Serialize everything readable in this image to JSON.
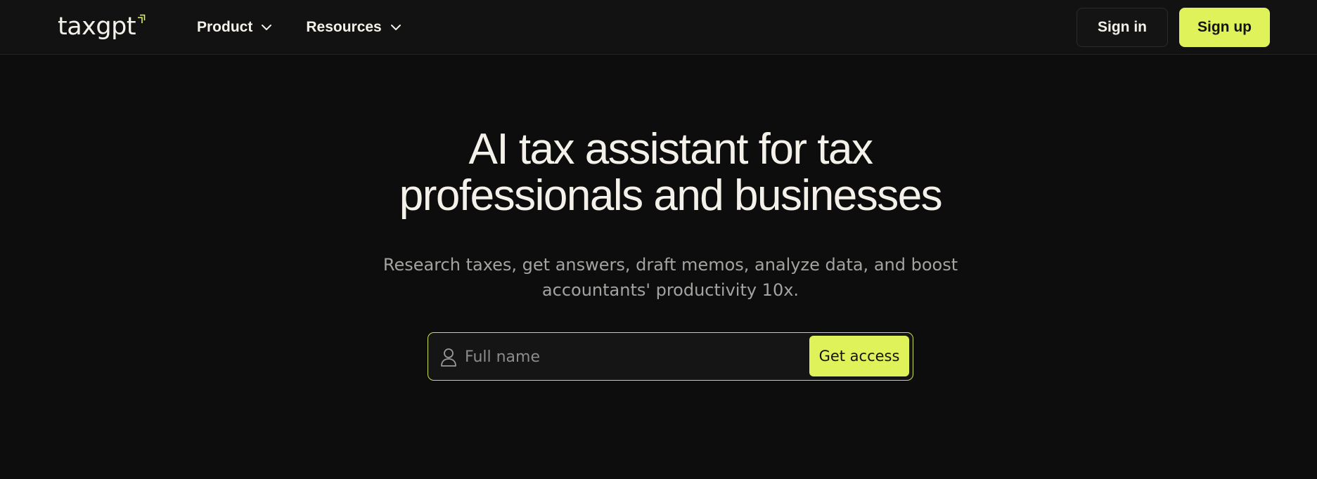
{
  "header": {
    "logo_text": "taxgpt",
    "nav": [
      {
        "label": "Product",
        "icon": "chevron-down-icon"
      },
      {
        "label": "Resources",
        "icon": "chevron-down-icon"
      }
    ],
    "signin_label": "Sign in",
    "signup_label": "Sign up"
  },
  "hero": {
    "title_line1": "AI tax assistant for tax",
    "title_line2": "professionals and businesses",
    "subtitle_line1": "Research taxes, get answers, draft memos, analyze data, and boost",
    "subtitle_line2": "accountants' productivity 10x."
  },
  "signup_form": {
    "input_icon": "user-icon",
    "input_placeholder": "Full name",
    "input_value": "",
    "submit_label": "Get access"
  },
  "colors": {
    "background": "#0d0d0d",
    "header_background": "#121212",
    "accent": "#e0f25a",
    "text_primary": "#f4f1ea",
    "text_secondary": "#a3a3a0"
  }
}
